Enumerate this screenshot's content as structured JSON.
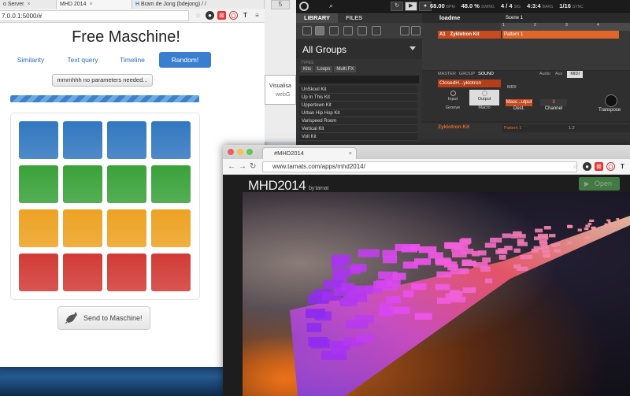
{
  "left_browser": {
    "tabs": [
      "o Server",
      "MHD 2014",
      "Bram de Jong (bdejong) / /"
    ],
    "url": "7.0.0.1:5000/#",
    "page_title": "Free Maschine!",
    "nav": [
      "Similarity",
      "Text query",
      "Timeline",
      "Random!"
    ],
    "no_params_button": "mmmhhh no parameters needed...",
    "progress": 1.0,
    "pad_colors": [
      "#3278c0",
      "#3aa23a",
      "#eda223",
      "#d23b37"
    ],
    "send_button": "Send to Maschine!"
  },
  "middle_window": {
    "tab": "5",
    "text1": "Visualisa",
    "text2": "webG"
  },
  "maschine": {
    "tempo": "68.00",
    "tempo_unit": "BPM",
    "swing": "48.0 %",
    "swing_unit": "SWING",
    "signature": "4 / 4",
    "signature_unit": "SIG",
    "position": "4:3:4",
    "position_unit": "BARS",
    "grid": "1/16",
    "grid_unit": "SYNC",
    "library_tabs": [
      "LIBRARY",
      "FILES"
    ],
    "all_groups": "All Groups",
    "types_label": "TYPES",
    "types": [
      "Kits",
      "Loops",
      "Multi FX"
    ],
    "library_items": [
      "UnSkool Kit",
      "Up In This Kit",
      "Uppertown Kit",
      "Urban Hip Hop Kit",
      "Varispeed Room",
      "Vertical Kit",
      "Volt Kit"
    ],
    "project": "loadme",
    "scene": "Scene 1",
    "ruler": [
      "1",
      "2",
      "3",
      "4"
    ],
    "group_slot": "A1",
    "group_name": "Zyklotron Kit",
    "pattern": "Pattern 1",
    "ctrl_tabs": [
      "MASTER",
      "GROUP",
      "SOUND"
    ],
    "ctrl_right_tabs": [
      "Audio",
      "Aux",
      "MIDI"
    ],
    "sound_name": "ClosedH...yklotron",
    "buttons": [
      "Input",
      "Output",
      "Groove",
      "Macro"
    ],
    "midi_label": "MIDI",
    "params": [
      {
        "label": "Dest.",
        "value": "Masc...utput"
      },
      {
        "label": "Channel",
        "value": "3"
      },
      {
        "label": "Transpose",
        "value": ""
      }
    ],
    "kit_name": "Zyklotron Kit",
    "pattern_bottom": "Pattern 1",
    "pattern_bottom_pos": "1.2"
  },
  "mhd_browser": {
    "tab_title": "#MHD2014",
    "url": "www.tamats.com/apps/mhd2014/",
    "title": "MHD2014",
    "byline": "by tamat",
    "open_button": "Open"
  }
}
